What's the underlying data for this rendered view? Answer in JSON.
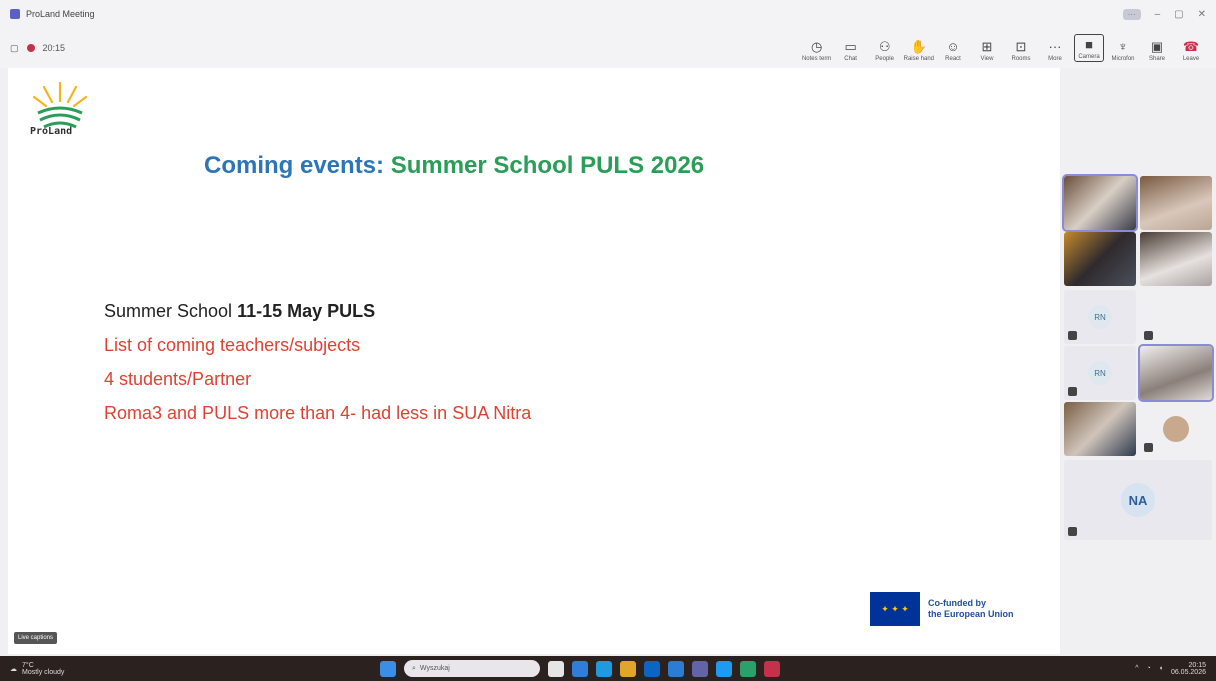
{
  "window": {
    "title": "ProLand Meeting"
  },
  "toolbar": {
    "timer": "20:15",
    "tools": [
      {
        "icon": "clock-icon",
        "label": "Notes term"
      },
      {
        "icon": "chat-icon",
        "label": "Chat"
      },
      {
        "icon": "people-icon",
        "label": "People"
      },
      {
        "icon": "raise-hand-icon",
        "label": "Raise hand"
      },
      {
        "icon": "react-icon",
        "label": "React"
      },
      {
        "icon": "view-icon",
        "label": "View"
      },
      {
        "icon": "rooms-icon",
        "label": "Rooms"
      },
      {
        "icon": "more-icon",
        "label": "More"
      },
      {
        "icon": "camera-icon",
        "label": "Camera"
      },
      {
        "icon": "mic-icon",
        "label": "Microfon"
      },
      {
        "icon": "share-icon",
        "label": "Share"
      },
      {
        "icon": "leave-icon",
        "label": "Leave"
      }
    ]
  },
  "slide": {
    "logo_text": "ProLand",
    "title_part1": "Coming events:",
    "title_part2": "Summer School PULS 2026",
    "bullet0_prefix": "Summer School",
    "bullet0_bold": "11-15 May PULS",
    "bullet1": "List of coming teachers/subjects",
    "bullet2": "4 students/Partner",
    "bullet3": "Roma3 and PULS more than 4- had less in SUA Nitra",
    "eu_line1": "Co-funded by",
    "eu_line2": "the European Union"
  },
  "caption_button": "Live captions",
  "participants": {
    "rn1": "RN",
    "rn2": "RN",
    "na": "NA"
  },
  "taskbar": {
    "temp": "7°C",
    "weather_desc": "Mostly cloudy",
    "search_placeholder": "Wyszukaj",
    "time": "20:15",
    "date": "06.05.2026"
  },
  "colors": {
    "title_blue": "#2e75b6",
    "title_green": "#2a9d57",
    "bullet_red": "#e04133",
    "accent": "#5b5fc7",
    "leave_red": "#c4314b"
  }
}
